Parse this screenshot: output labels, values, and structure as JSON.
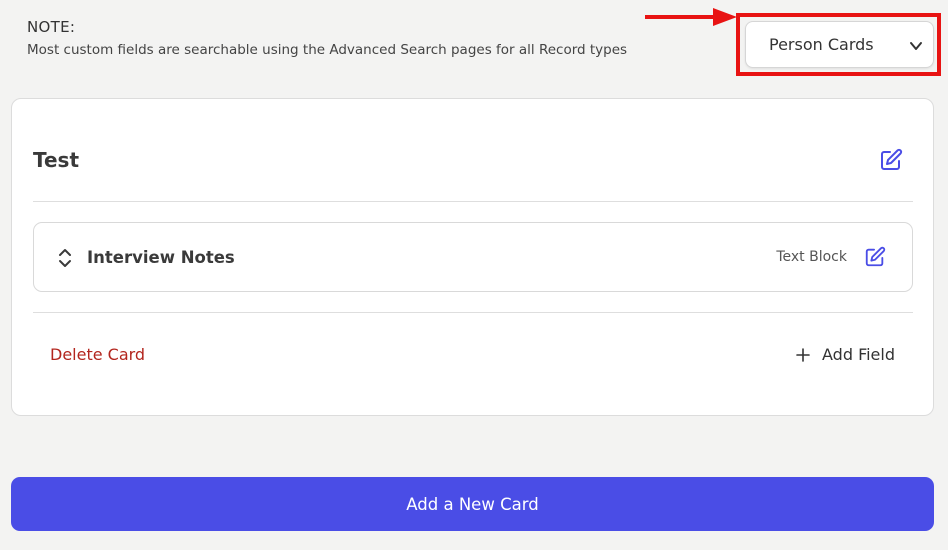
{
  "note": {
    "title": "NOTE:",
    "text": "Most custom fields are searchable using the Advanced Search pages for all Record types"
  },
  "card_type_select": {
    "selected": "Person Cards"
  },
  "card": {
    "title": "Test",
    "fields": [
      {
        "name": "Interview Notes",
        "type": "Text Block"
      }
    ],
    "delete_label": "Delete Card",
    "add_field_label": "Add Field"
  },
  "add_new_card_label": "Add a New Card",
  "colors": {
    "accent": "#4a4de6",
    "danger": "#b3261e",
    "annotation": "#e81313",
    "icon": "#4a4de6"
  }
}
